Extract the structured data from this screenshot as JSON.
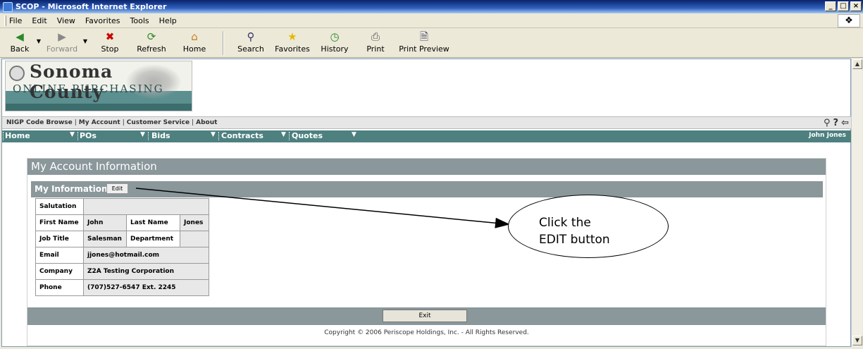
{
  "window": {
    "title": "SCOP - Microsoft Internet Explorer",
    "controls": [
      "_",
      "□",
      "×"
    ]
  },
  "menu": [
    "File",
    "Edit",
    "View",
    "Favorites",
    "Tools",
    "Help"
  ],
  "toolbar": {
    "back": "Back",
    "forward": "Forward",
    "stop": "Stop",
    "refresh": "Refresh",
    "home": "Home",
    "search": "Search",
    "favorites": "Favorites",
    "history": "History",
    "print": "Print",
    "print_preview": "Print Preview"
  },
  "logo": {
    "title": "Sonoma County",
    "subtitle": "ONLINE PURCHASING"
  },
  "nav_links": [
    "NIGP Code Browse",
    "My Account",
    "Customer Service",
    "About"
  ],
  "main_nav": {
    "items": [
      "Home",
      "POs",
      "Bids",
      "Contracts",
      "Quotes"
    ],
    "user": "John Jones"
  },
  "panel": {
    "title": "My Account Information",
    "section_title": "My Information",
    "edit_label": "Edit",
    "exit_label": "Exit",
    "copyright": "Copyright © 2006 Periscope Holdings, Inc. - All Rights Reserved."
  },
  "info": {
    "salutation_label": "Salutation",
    "salutation": "",
    "first_name_label": "First Name",
    "first_name": "John",
    "last_name_label": "Last Name",
    "last_name": "Jones",
    "job_title_label": "Job Title",
    "job_title": "Salesman",
    "department_label": "Department",
    "department": "",
    "email_label": "Email",
    "email": "jjones@hotmail.com",
    "company_label": "Company",
    "company": "Z2A Testing Corporation",
    "phone_label": "Phone",
    "phone": "(707)527-6547 Ext. 2245"
  },
  "callout": {
    "line1": "Click the",
    "line2": "EDIT button"
  }
}
